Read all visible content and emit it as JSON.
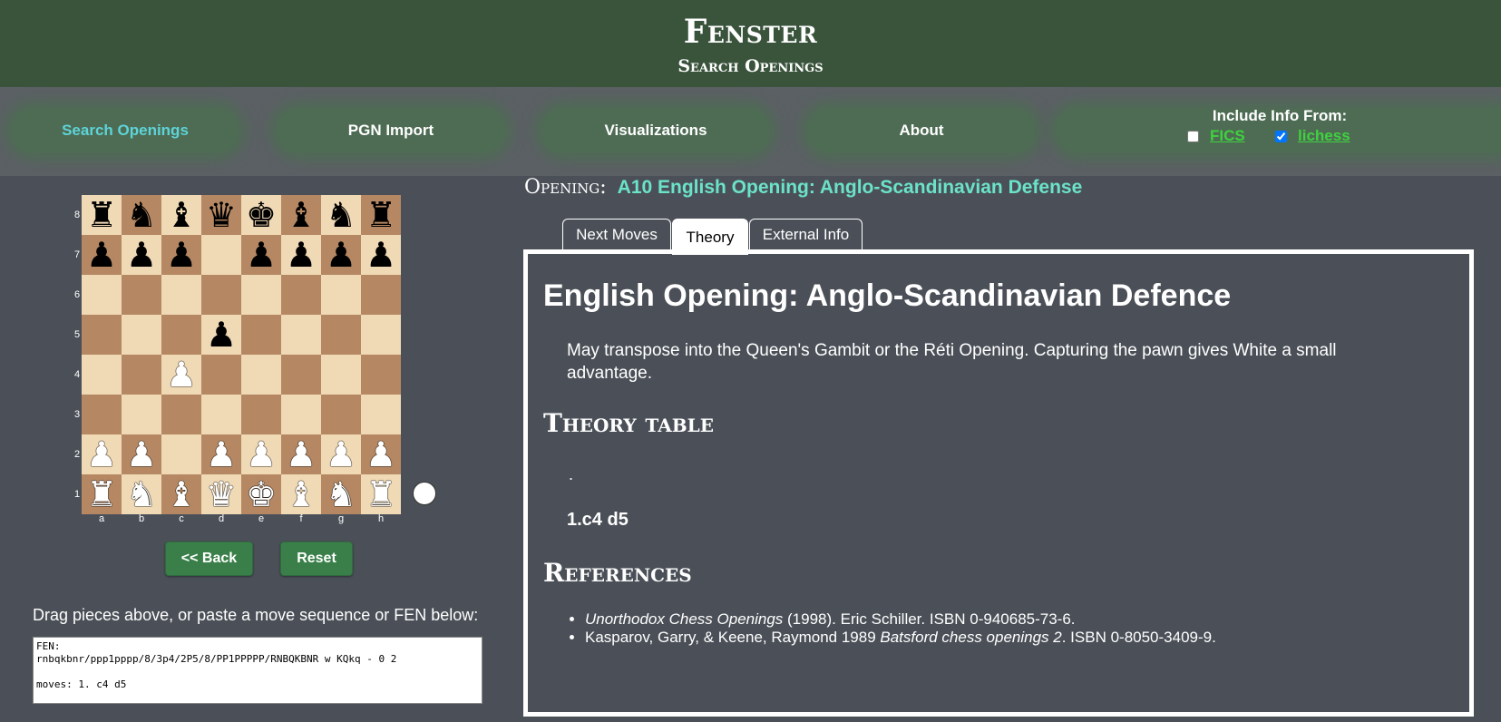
{
  "header": {
    "title": "Fenster",
    "subtitle": "Search Openings"
  },
  "nav": {
    "items": [
      "Search Openings",
      "PGN Import",
      "Visualizations",
      "About"
    ],
    "active_index": 0,
    "include_info_label": "Include Info From:",
    "sources": [
      {
        "label": "FICS",
        "checked": false
      },
      {
        "label": "lichess",
        "checked": true
      }
    ]
  },
  "board": {
    "ranks": [
      "8",
      "7",
      "6",
      "5",
      "4",
      "3",
      "2",
      "1"
    ],
    "files": [
      "a",
      "b",
      "c",
      "d",
      "e",
      "f",
      "g",
      "h"
    ],
    "position_fen": "rnbqkbnr/ppp1pppp/8/3p4/2P5/8/PP1PPPPP/RNBQKBNR",
    "side_to_move": "white"
  },
  "buttons": {
    "back": "<< Back",
    "reset": "Reset"
  },
  "input": {
    "hint": "Drag pieces above, or paste a move sequence or FEN below:",
    "value": "FEN:\nrnbqkbnr/ppp1pppp/8/3p4/2P5/8/PP1PPPPP/RNBQKBNR w KQkq - 0 2\n\nmoves: 1. c4 d5"
  },
  "opening": {
    "label": "Opening:",
    "name": "A10 English Opening: Anglo-Scandinavian Defense"
  },
  "tabs": [
    "Next Moves",
    "Theory",
    "External Info"
  ],
  "active_tab": 1,
  "theory": {
    "title": "English Opening: Anglo-Scandinavian Defence",
    "description": "May transpose into the Queen's Gambit or the Réti Opening. Capturing the pawn gives White a small advantage.",
    "table_heading": "Theory table",
    "table_dot": ".",
    "moves": "1.c4 d5",
    "references_heading": "References",
    "references": [
      {
        "italic": "Unorthodox Chess Openings",
        "text": " (1998). Eric Schiller. ISBN 0-940685-73-6."
      },
      {
        "pre": "Kasparov, Garry, & Keene, Raymond 1989 ",
        "italic": "Batsford chess openings 2",
        "text": ". ISBN 0-8050-3409-9."
      }
    ]
  },
  "colors": {
    "header_bg": "#3a543c",
    "accent_cyan": "#5ed3d8",
    "opening_name": "#6be3c8",
    "link_green": "#3fd13f",
    "light_square": "#f0d9b5",
    "dark_square": "#b58863",
    "button_green": "#3a7f49"
  }
}
